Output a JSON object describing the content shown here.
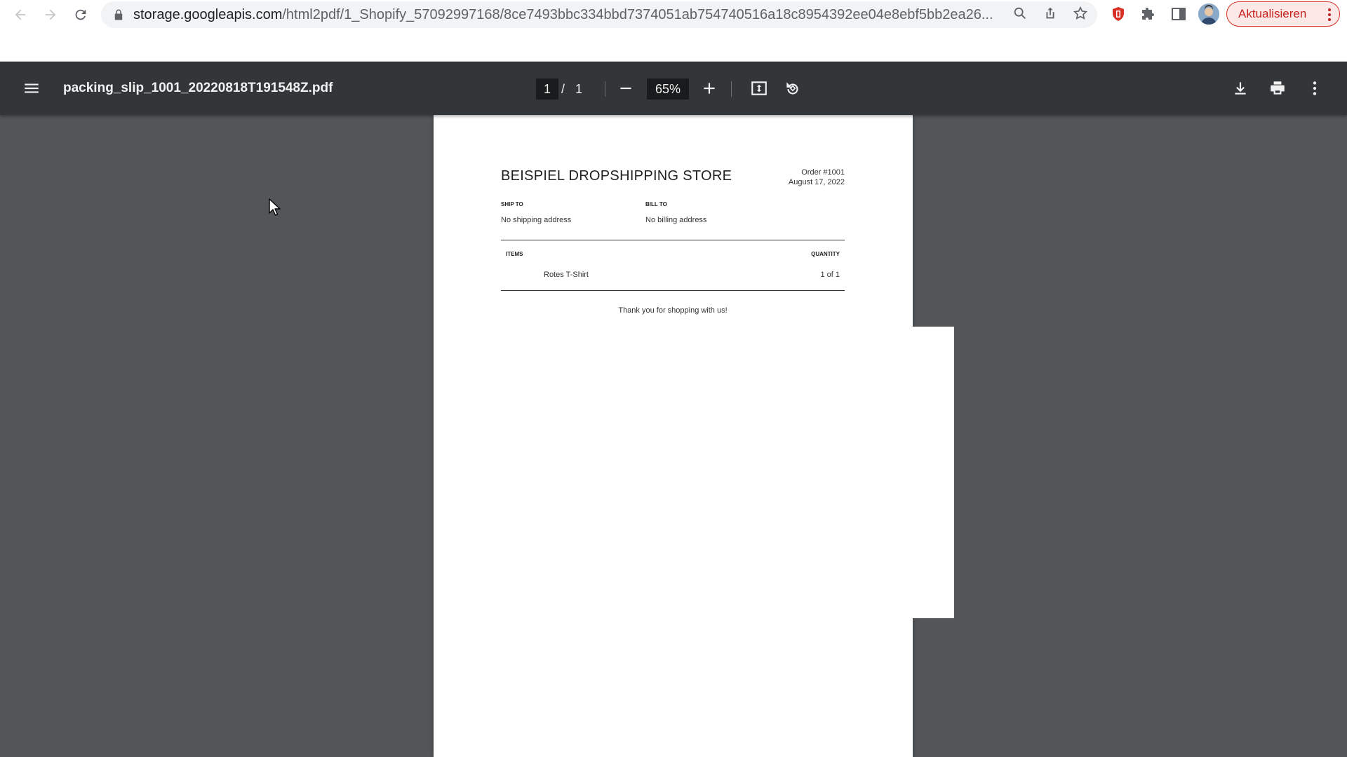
{
  "browser": {
    "url_host": "storage.googleapis.com",
    "url_path": "/html2pdf/1_Shopify_57092997168/8ce7493bbc334bbd7374051ab754740516a18c8954392ee04e8ebf5bb2ea26...",
    "update_label": "Aktualisieren"
  },
  "pdf_toolbar": {
    "file_name": "packing_slip_1001_20220818T191548Z.pdf",
    "current_page": "1",
    "page_separator": "/",
    "total_pages": "1",
    "zoom": "65%"
  },
  "slip": {
    "store_name": "BEISPIEL DROPSHIPPING STORE",
    "order_number": "Order #1001",
    "order_date": "August 17, 2022",
    "ship_to_label": "SHIP TO",
    "ship_to_value": "No shipping address",
    "bill_to_label": "BILL TO",
    "bill_to_value": "No billing address",
    "items_header": "ITEMS",
    "quantity_header": "QUANTITY",
    "items": [
      {
        "name": "Rotes T-Shirt",
        "quantity": "1 of 1"
      }
    ],
    "thank_you": "Thank you for shopping with us!"
  },
  "colors": {
    "toolbar_bg": "#323639",
    "viewer_bg": "#525659",
    "update_accent": "#c5221f",
    "extension_red": "#d93025"
  },
  "icons": {
    "back": "arrow-left-icon",
    "forward": "arrow-right-icon",
    "reload": "reload-icon",
    "lock": "lock-icon",
    "zoom": "magnifier-icon",
    "share": "share-icon",
    "bookmark": "star-icon",
    "extension_shield": "red-shield-icon",
    "extensions": "puzzle-icon",
    "side_panel": "side-panel-icon",
    "menu": "hamburger-menu-icon",
    "zoom_out": "minus-icon",
    "zoom_in": "plus-icon",
    "fit_page": "fit-to-page-icon",
    "rotate": "rotate-ccw-icon",
    "download": "download-icon",
    "print": "printer-icon",
    "more": "vertical-dots-icon"
  }
}
